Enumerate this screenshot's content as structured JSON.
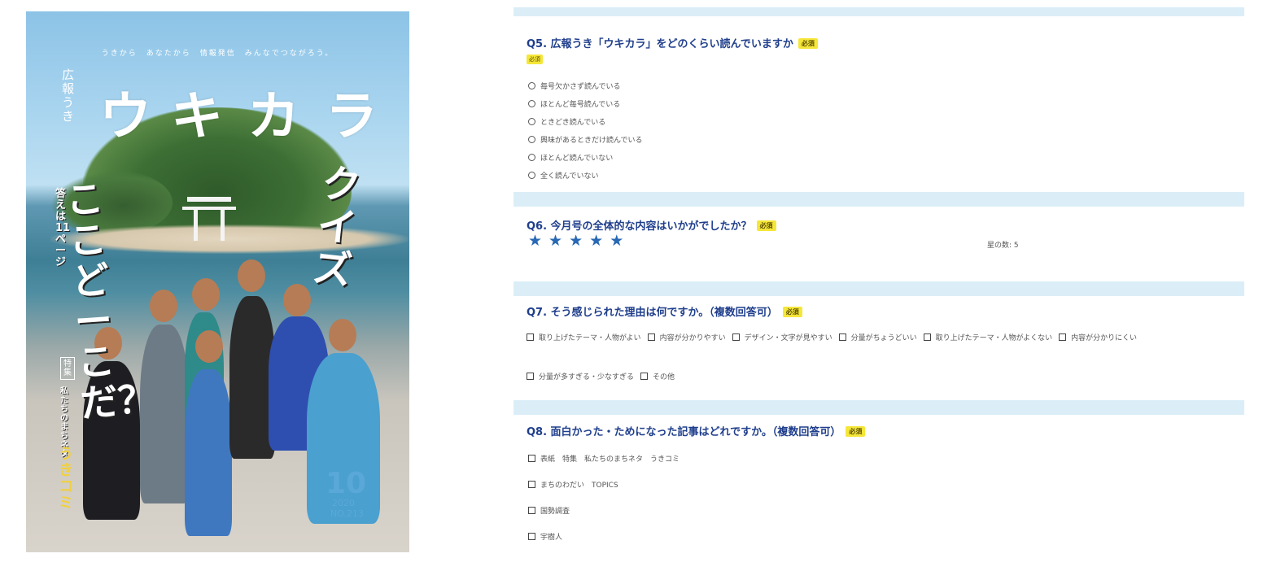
{
  "cover": {
    "tagline": "うきから　あなたから　情報発信　みんなでつながろう。",
    "brand_small": "広報うき",
    "title_chars": [
      "ウ",
      "キ",
      "カ",
      "ラ"
    ],
    "quiz_left": "ここどーこだ？",
    "quiz_right": "クイズ",
    "answer_page": "答えは11ページ",
    "feature_label": "特集",
    "feature_title": "私たちのまちネタ",
    "feature_name": "うきコミ",
    "issue_month": "10",
    "issue_year": "2020",
    "issue_no": "NO.213"
  },
  "form": {
    "required_badge": "必須",
    "q5": {
      "title": "Q5. 広報うき「ウキカラ」をどのくらい読んでいますか",
      "options": [
        "毎号欠かさず読んでいる",
        "ほとんど毎号読んでいる",
        "ときどき読んでいる",
        "興味があるときだけ読んでいる",
        "ほとんど読んでいない",
        "全く読んでいない"
      ]
    },
    "q6": {
      "title": "Q6. 今月号の全体的な内容はいかがでしたか？",
      "rating": 5,
      "rating_max": 5,
      "rating_label": "星の数: 5"
    },
    "q7": {
      "title": "Q7. そう感じられた理由は何ですか。（複数回答可）",
      "row1": [
        "取り上げたテーマ・人物がよい",
        "内容が分かりやすい",
        "デザイン・文字が見やすい",
        "分量がちょうどいい",
        "取り上げたテーマ・人物がよくない",
        "内容が分かりにくい"
      ],
      "row2": [
        "分量が多すぎる・少なすぎる",
        "その他"
      ]
    },
    "q8": {
      "title": "Q8. 面白かった・ためになった記事はどれですか。（複数回答可）",
      "options": [
        "表紙　特集　私たちのまちネタ　うきコミ",
        "まちのわだい　TOPICS",
        "国勢調査",
        "宇樹人"
      ]
    }
  },
  "colors": {
    "question_title": "#1f3e8c",
    "required_bg": "#f5e63a",
    "star": "#2868b4",
    "form_bg": "#dbeef8"
  }
}
